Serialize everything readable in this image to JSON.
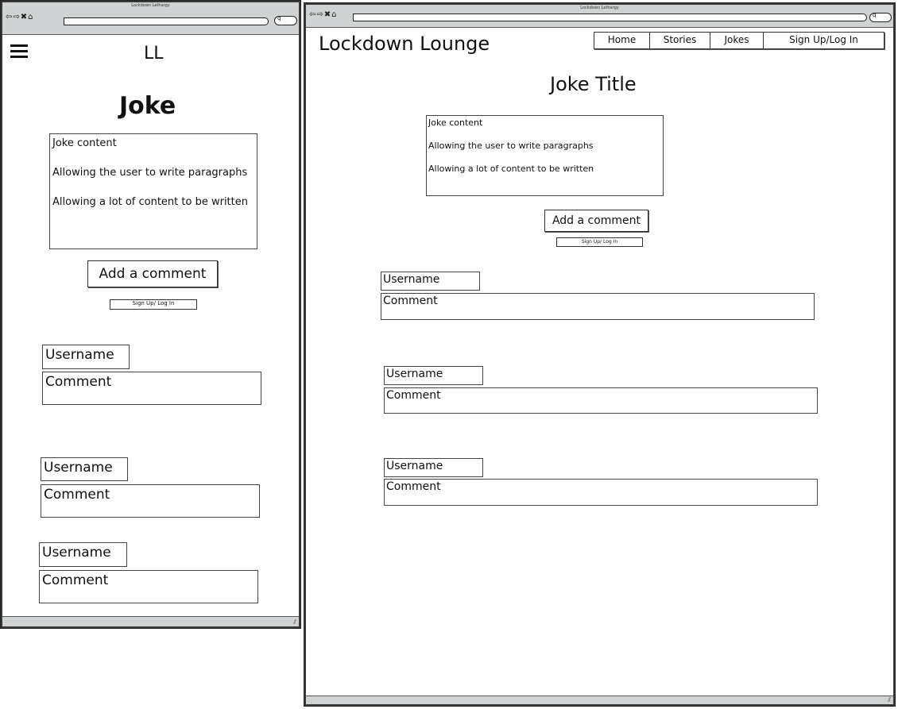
{
  "window_title": "Lockdown Lethargy",
  "search_glyph": "q",
  "mobile": {
    "logo": "LL",
    "page_title": "Joke",
    "content_lines": [
      "Joke content",
      "Allowing the user to write paragraphs",
      "Allowing a lot of content to be written"
    ],
    "add_comment_label": "Add a comment",
    "signup_label": "Sign Up/ Log In",
    "comments": [
      {
        "username": "Username",
        "comment": "Comment"
      },
      {
        "username": "Username",
        "comment": "Comment"
      },
      {
        "username": "Username",
        "comment": "Comment"
      }
    ]
  },
  "desktop": {
    "site_title": "Lockdown Lounge",
    "nav": [
      "Home",
      "Stories",
      "Jokes",
      "Sign Up/Log In"
    ],
    "page_title": "Joke Title",
    "content_lines": [
      "Joke content",
      "Allowing the user to write paragraphs",
      "Allowing a lot of content to be written"
    ],
    "add_comment_label": "Add a comment",
    "signup_label": "Sign Up/ Log In",
    "comments": [
      {
        "username": "Username",
        "comment": "Comment"
      },
      {
        "username": "Username",
        "comment": "Comment"
      },
      {
        "username": "Username",
        "comment": "Comment"
      }
    ]
  }
}
